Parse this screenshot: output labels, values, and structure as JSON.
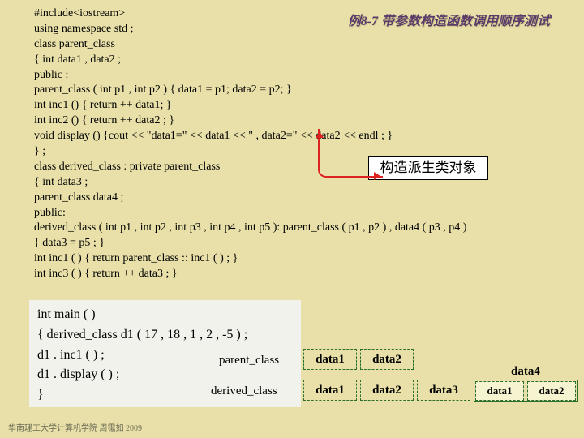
{
  "title": "例8-7  带参数构造函数调用顺序测试",
  "code": {
    "l1": "#include<iostream>",
    "l2": "using namespace std ;",
    "l3": "class  parent_class",
    "l4": "{      int  data1 , data2 ;",
    "l5": "   public :",
    "l6": "       parent_class ( int  p1 , int  p2 ) { data1 = p1; data2 = p2; }",
    "l7": "       int  inc1 () { return  ++ data1; }",
    "l8": "       int  inc2 () { return  ++ data2 ; }",
    "l9": "       void  display  ()  {cout << \"data1=\" << data1 << \" , data2=\" << data2 << endl ; }",
    "l10": "} ;",
    "l11": "class  derived_class : private  parent_class",
    "l12": "{      int  data3 ;",
    "l13": "       parent_class  data4 ;",
    "l14": "   public:",
    "l15": "       derived_class ( int  p1 , int  p2 , int  p3 , int  p4 , int  p5 ): parent_class ( p1 , p2 ) , data4 ( p3 , p4 )",
    "l16": "          { data3 = p5 ; }",
    "l17": "       int  inc1 ( ) { return  parent_class :: inc1 ( ) ; }",
    "l18": "       int  inc3 ( ) { return  ++ data3 ; }"
  },
  "annotation": "构造派生类对象",
  "main": {
    "m1": "int main ( )",
    "m2": "{ derived_class  d1 ( 17 , 18 , 1 , 2 , -5 ) ;",
    "m3": "   d1 . inc1 ( ) ;",
    "m4": "   d1 . display ( ) ;",
    "m5": "}"
  },
  "diag": {
    "row1label": "parent_class",
    "row2label": "derived_class",
    "c1": "data1",
    "c2": "data2",
    "c3": "data3",
    "c4outer": "data4",
    "c4a": "data1",
    "c4b": "data2"
  },
  "footer": "华南理工大学计算机学院 周霭如 2009"
}
